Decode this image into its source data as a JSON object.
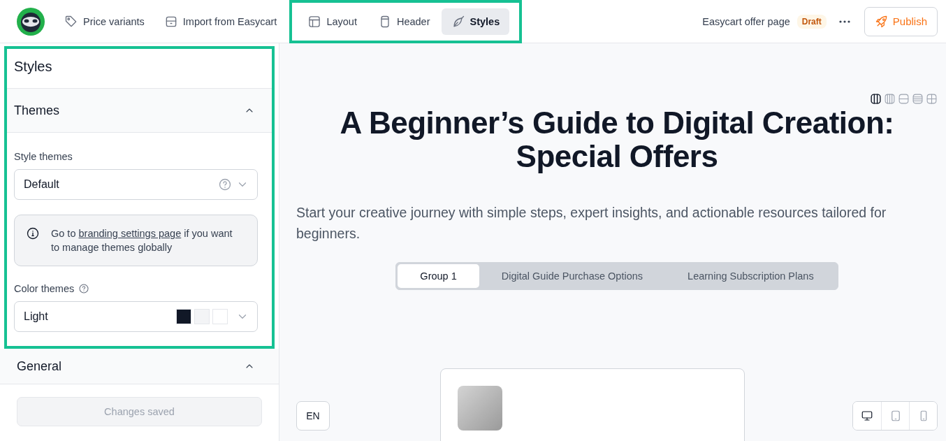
{
  "topbar": {
    "nav": [
      {
        "label": "Price variants",
        "kind": "tag"
      },
      {
        "label": "Import from Easycart",
        "kind": "box"
      }
    ],
    "view_tabs": {
      "highlighted": true,
      "tabs": [
        {
          "label": "Layout",
          "kind": "layout",
          "selected": false
        },
        {
          "label": "Header",
          "kind": "header",
          "selected": false
        },
        {
          "label": "Styles",
          "kind": "styles",
          "selected": true
        }
      ]
    },
    "page_name": "Easycart offer page",
    "status_badge": "Draft",
    "publish_button": "Publish"
  },
  "sidebar": {
    "highlighted": true,
    "title": "Styles",
    "themes_section": {
      "title": "Themes",
      "expanded": true,
      "style_themes": {
        "label": "Style themes",
        "value": "Default"
      },
      "info": {
        "before": "Go to ",
        "link": "branding settings page",
        "after": " if you want to manage themes globally"
      },
      "color_themes": {
        "label": "Color themes",
        "value": "Light",
        "swatches": [
          {
            "color": "#111827"
          },
          {
            "color": "#f3f4f6"
          },
          {
            "color": "#ffffff"
          }
        ]
      }
    },
    "general_section": {
      "title": "General",
      "expanded": true
    },
    "save_button": {
      "label": "Changes saved",
      "disabled": true
    }
  },
  "preview": {
    "layout_options": [
      {
        "kind": "two-columns",
        "selected": true
      },
      {
        "kind": "three-columns",
        "selected": false
      },
      {
        "kind": "two-rows",
        "selected": false
      },
      {
        "kind": "four-rows",
        "selected": false
      },
      {
        "kind": "grid",
        "selected": false
      }
    ],
    "heading": "A Beginner’s Guide to Digital Creation: Special Offers",
    "subtitle": "Start your creative journey with simple steps, expert insights, and actionable resources tailored for beginners.",
    "group_tabs": [
      {
        "label": "Group 1",
        "selected": true
      },
      {
        "label": "Digital Guide Purchase Options",
        "selected": false
      },
      {
        "label": "Learning Subscription Plans",
        "selected": false
      }
    ],
    "language_button": "EN",
    "device_options": [
      {
        "kind": "desktop",
        "selected": true
      },
      {
        "kind": "tablet",
        "selected": false
      },
      {
        "kind": "phone",
        "selected": false
      }
    ]
  }
}
